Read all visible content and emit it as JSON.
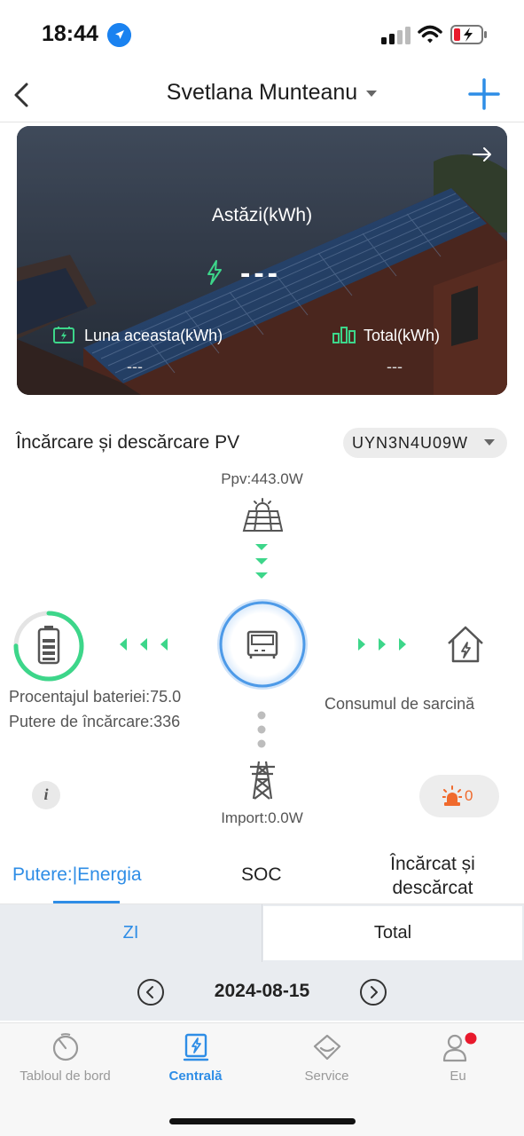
{
  "status_bar": {
    "time": "18:44"
  },
  "header": {
    "title": "Svetlana Munteanu"
  },
  "hero": {
    "today_label": "Astăzi(kWh)",
    "today_value": "---",
    "month_label": "Luna aceasta(kWh)",
    "month_value": "---",
    "total_label": "Total(kWh)",
    "total_value": "---"
  },
  "pv_section": {
    "title": "Încărcare și descărcare PV",
    "device": "UYN3N4U09W",
    "ppv": "Ppv:443.0W",
    "battery_percent": "Procentajul bateriei:75.0",
    "battery_level": 0.75,
    "charge_power": "Putere de încărcare:336",
    "load": "Consumul de sarcină",
    "import": "Import:0.0W",
    "alarm_count": "0",
    "info_label": "i"
  },
  "tabs": {
    "power": "Putere:|Energia",
    "soc": "SOC",
    "charge": "Încărcat și descărcat"
  },
  "range": {
    "day": "ZI",
    "total": "Total"
  },
  "date": "2024-08-15",
  "bottom_nav": {
    "dashboard": "Tabloul de bord",
    "plant": "Centrală",
    "service": "Service",
    "me": "Eu"
  },
  "colors": {
    "accent": "#2e8de6",
    "green": "#3dd68a",
    "alarm": "#f06a2d",
    "badge": "#e8192c"
  }
}
